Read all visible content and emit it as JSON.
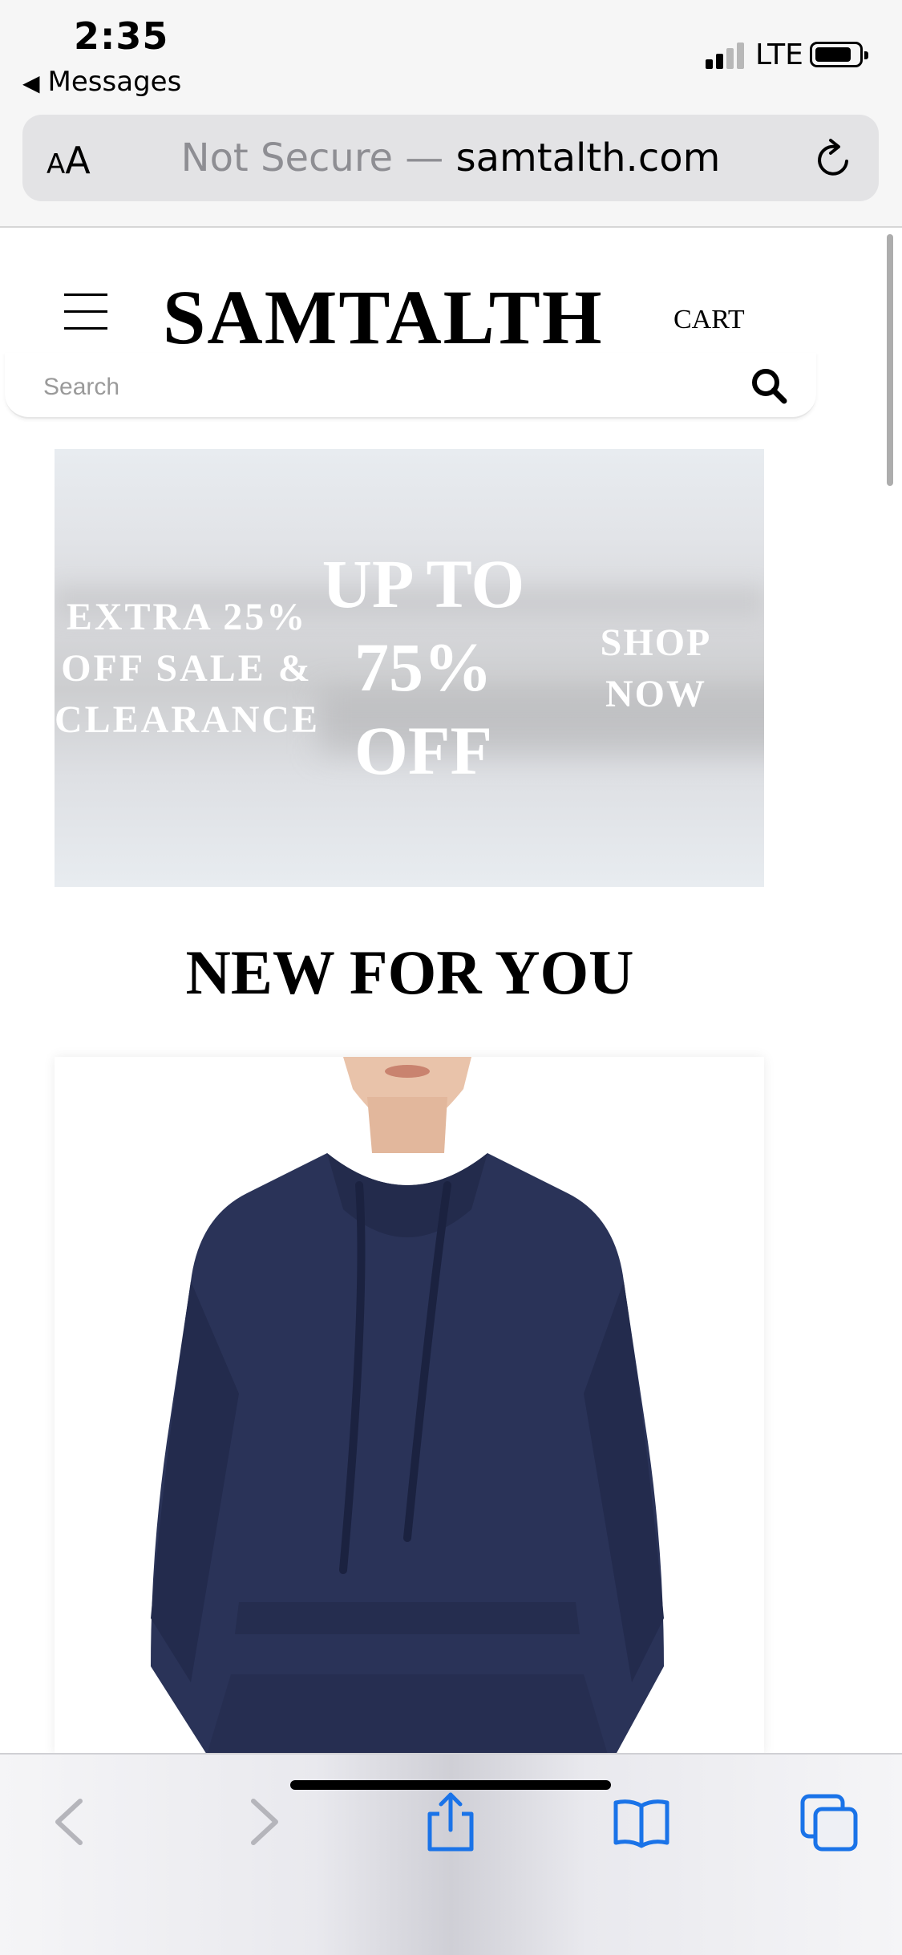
{
  "status_bar": {
    "time": "2:35",
    "back_app": "Messages",
    "network": "LTE"
  },
  "browser": {
    "text_size_label": "AA",
    "security_label": "Not Secure —",
    "domain": "samtalth.com"
  },
  "site": {
    "logo": "SAMTALTH",
    "cart_label": "CART",
    "search_placeholder": "Search"
  },
  "banner": {
    "left_line1": "EXTRA 25%",
    "left_line2": "OFF SALE &",
    "left_line3": "CLEARANCE",
    "mid_line1": "UP TO",
    "mid_line2": "75%",
    "mid_line3": "OFF",
    "right_line1": "SHOP",
    "right_line2": "NOW"
  },
  "section": {
    "title": "NEW FOR YOU"
  },
  "icons": {
    "menu": "hamburger-icon",
    "search": "search-icon",
    "reload": "reload-icon",
    "back": "back-arrow-icon",
    "forward": "forward-arrow-icon",
    "share": "share-icon",
    "bookmarks": "book-icon",
    "tabs": "tabs-icon"
  },
  "colors": {
    "accent": "#1a73e8",
    "product_navy": "#2a3358"
  }
}
